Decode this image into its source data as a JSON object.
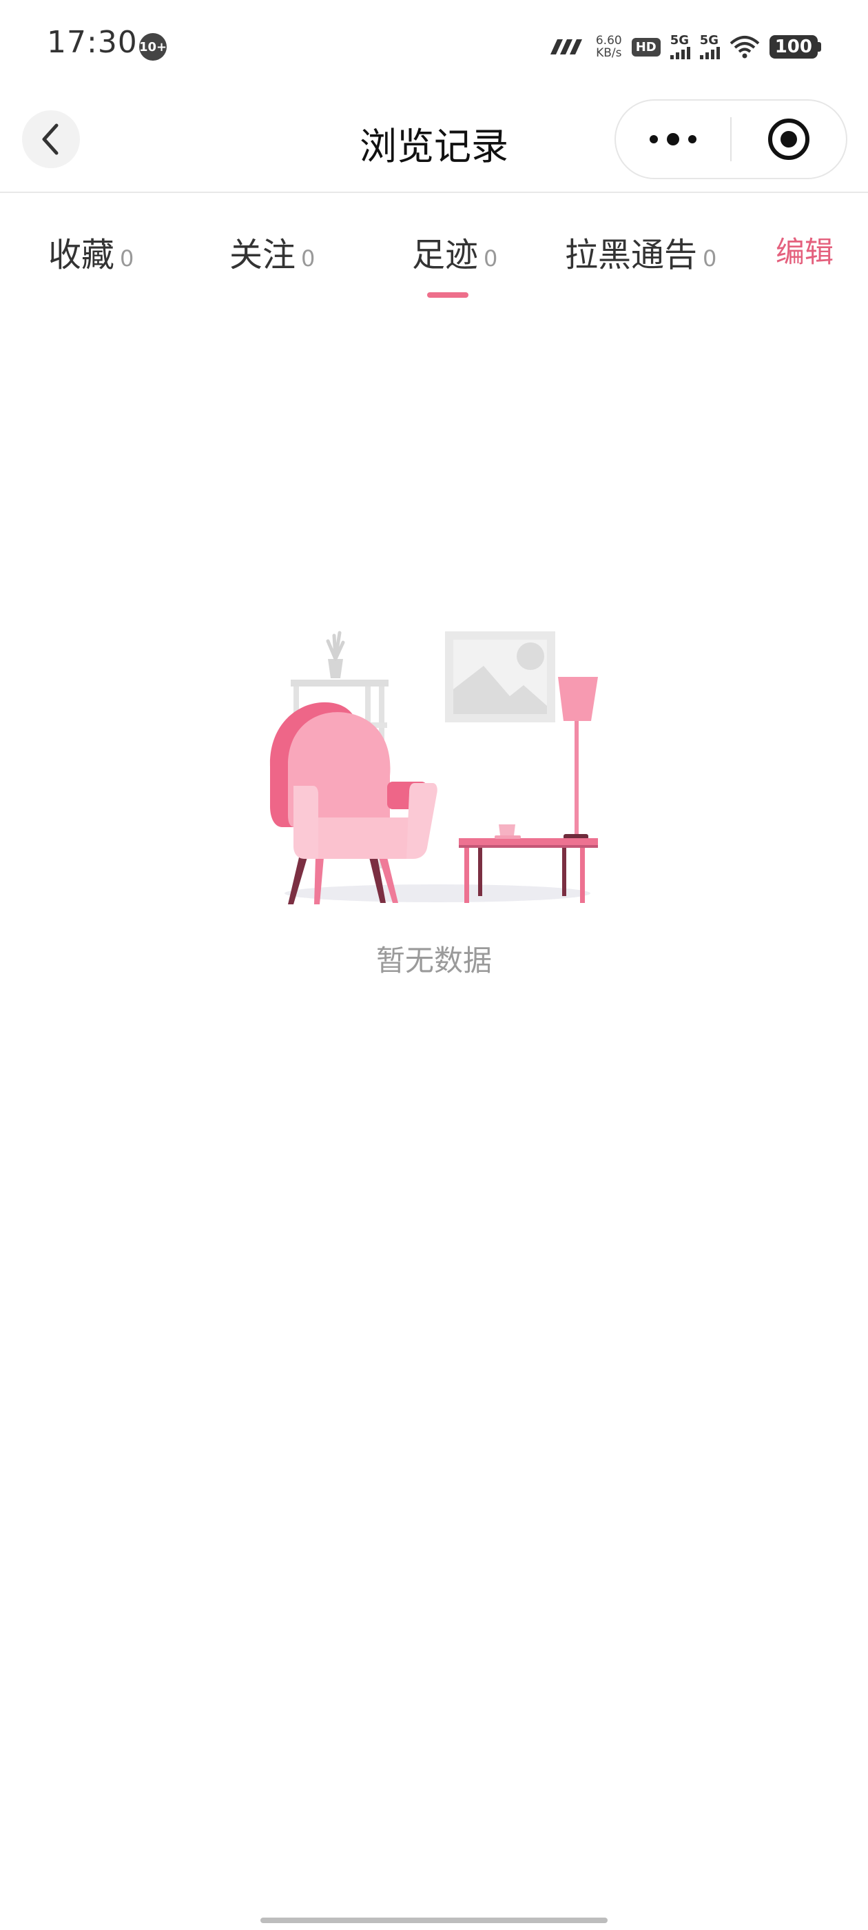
{
  "status_bar": {
    "time": "17:30",
    "notification_badge": "10+",
    "net_speed_value": "6.60",
    "net_speed_unit": "KB/s",
    "hd_label": "HD",
    "signal1_label": "5G",
    "signal2_label": "5G",
    "battery": "100"
  },
  "nav": {
    "title": "浏览记录",
    "back_icon": "chevron-left-icon",
    "more_icon": "more-dots-icon",
    "close_icon": "target-circle-icon"
  },
  "tabs": [
    {
      "label": "收藏",
      "count": "0",
      "active": false
    },
    {
      "label": "关注",
      "count": "0",
      "active": false
    },
    {
      "label": "足迹",
      "count": "0",
      "active": true
    },
    {
      "label": "拉黑通告",
      "count": "0",
      "active": false
    }
  ],
  "edit_label": "编辑",
  "empty_state": {
    "message": "暂无数据",
    "illustration": "armchair-room-illustration"
  },
  "colors": {
    "accent": "#e4607d",
    "indicator": "#ee6f8b",
    "chair_main": "#f98fa7",
    "chair_dark": "#e85a7c",
    "muted_text": "#9a9a9a"
  }
}
